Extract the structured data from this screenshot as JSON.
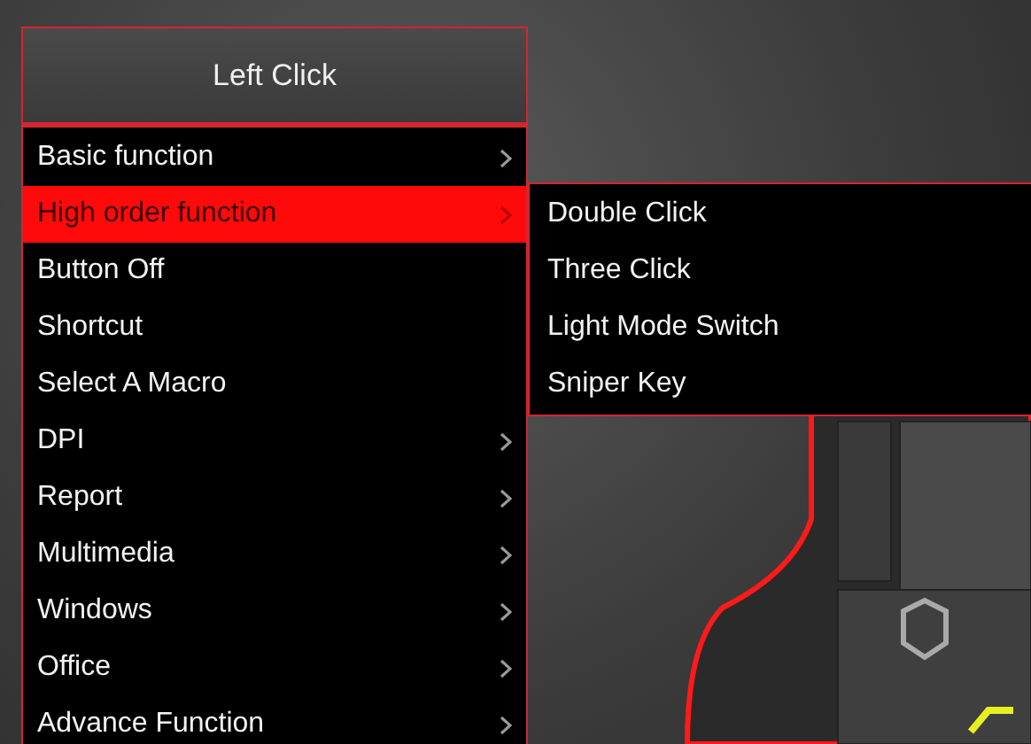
{
  "header": {
    "title": "Left Click"
  },
  "menu": [
    {
      "label": "Basic function",
      "has_submenu": true,
      "selected": false
    },
    {
      "label": "High order function",
      "has_submenu": true,
      "selected": true
    },
    {
      "label": "Button Off",
      "has_submenu": false,
      "selected": false
    },
    {
      "label": "Shortcut",
      "has_submenu": false,
      "selected": false
    },
    {
      "label": "Select A Macro",
      "has_submenu": false,
      "selected": false
    },
    {
      "label": "DPI",
      "has_submenu": true,
      "selected": false
    },
    {
      "label": "Report",
      "has_submenu": true,
      "selected": false
    },
    {
      "label": "Multimedia",
      "has_submenu": true,
      "selected": false
    },
    {
      "label": "Windows",
      "has_submenu": true,
      "selected": false
    },
    {
      "label": "Office",
      "has_submenu": true,
      "selected": false
    },
    {
      "label": "Advance Function",
      "has_submenu": true,
      "selected": false
    }
  ],
  "submenu": [
    {
      "label": "Double Click"
    },
    {
      "label": "Three Click"
    },
    {
      "label": "Light Mode Switch"
    },
    {
      "label": "Sniper Key"
    }
  ]
}
